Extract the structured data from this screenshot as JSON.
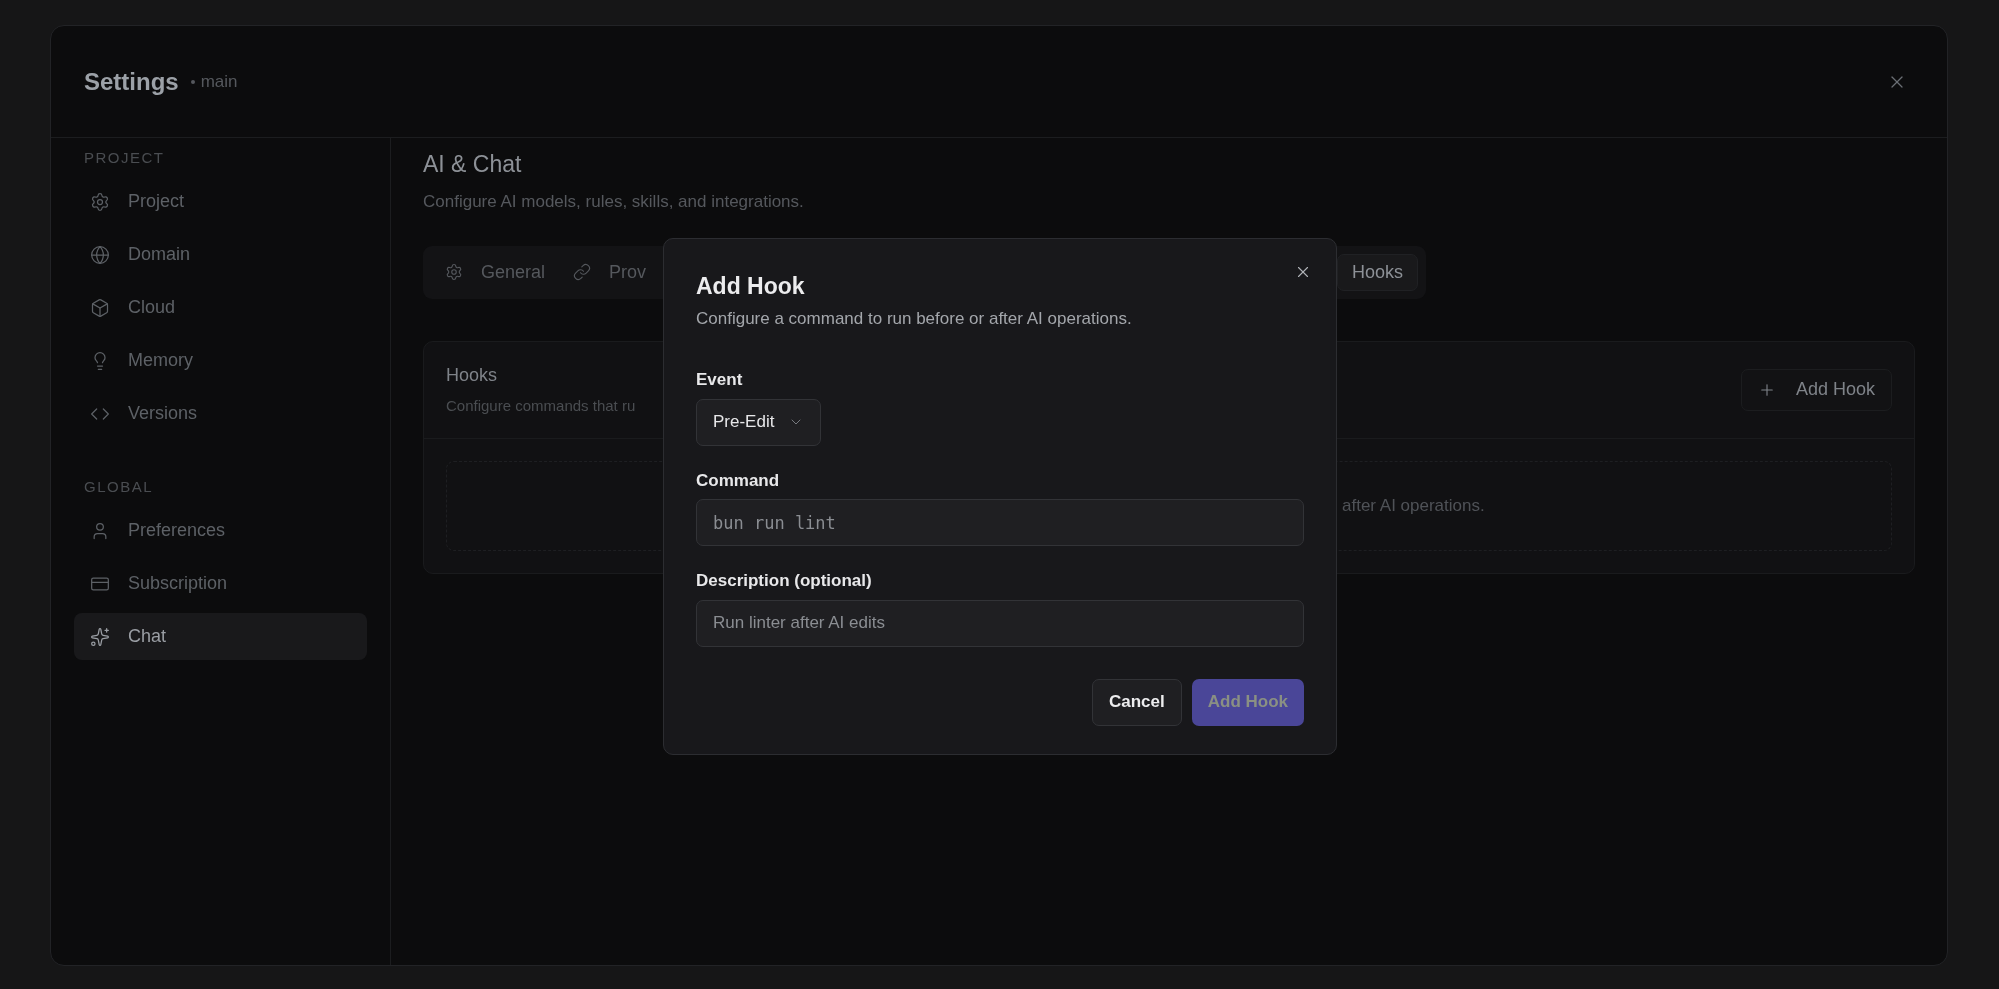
{
  "window": {
    "title": "Settings",
    "branch": "main"
  },
  "sidebar": {
    "sections": [
      {
        "label": "PROJECT",
        "items": [
          {
            "label": "Project",
            "selected": false
          },
          {
            "label": "Domain",
            "selected": false
          },
          {
            "label": "Cloud",
            "selected": false
          },
          {
            "label": "Memory",
            "selected": false
          },
          {
            "label": "Versions",
            "selected": false
          }
        ]
      },
      {
        "label": "GLOBAL",
        "items": [
          {
            "label": "Preferences",
            "selected": false
          },
          {
            "label": "Subscription",
            "selected": false
          },
          {
            "label": "Chat",
            "selected": true
          }
        ]
      }
    ]
  },
  "page": {
    "title": "AI & Chat",
    "subtitle": "Configure AI models, rules, skills, and integrations."
  },
  "tabs": [
    {
      "label": "General",
      "selected": false
    },
    {
      "label": "Prov",
      "selected": false
    },
    {
      "label": "Hooks",
      "selected": true
    }
  ],
  "hooks_card": {
    "title": "Hooks",
    "description": "Configure commands that ru",
    "add_button": "Add Hook",
    "empty_text": "after AI operations."
  },
  "dialog": {
    "title": "Add Hook",
    "description": "Configure a command to run before or after AI operations.",
    "fields": [
      {
        "kind": "select",
        "label": "Event",
        "value": "Pre-Edit"
      },
      {
        "kind": "code",
        "label": "Command",
        "placeholder": "bun run lint"
      },
      {
        "kind": "text",
        "label": "Description (optional)",
        "placeholder": "Run linter after AI edits"
      }
    ],
    "buttons": [
      {
        "label": "Cancel",
        "kind": "secondary",
        "disabled": false
      },
      {
        "label": "Add Hook",
        "kind": "primary",
        "disabled": true
      }
    ]
  }
}
